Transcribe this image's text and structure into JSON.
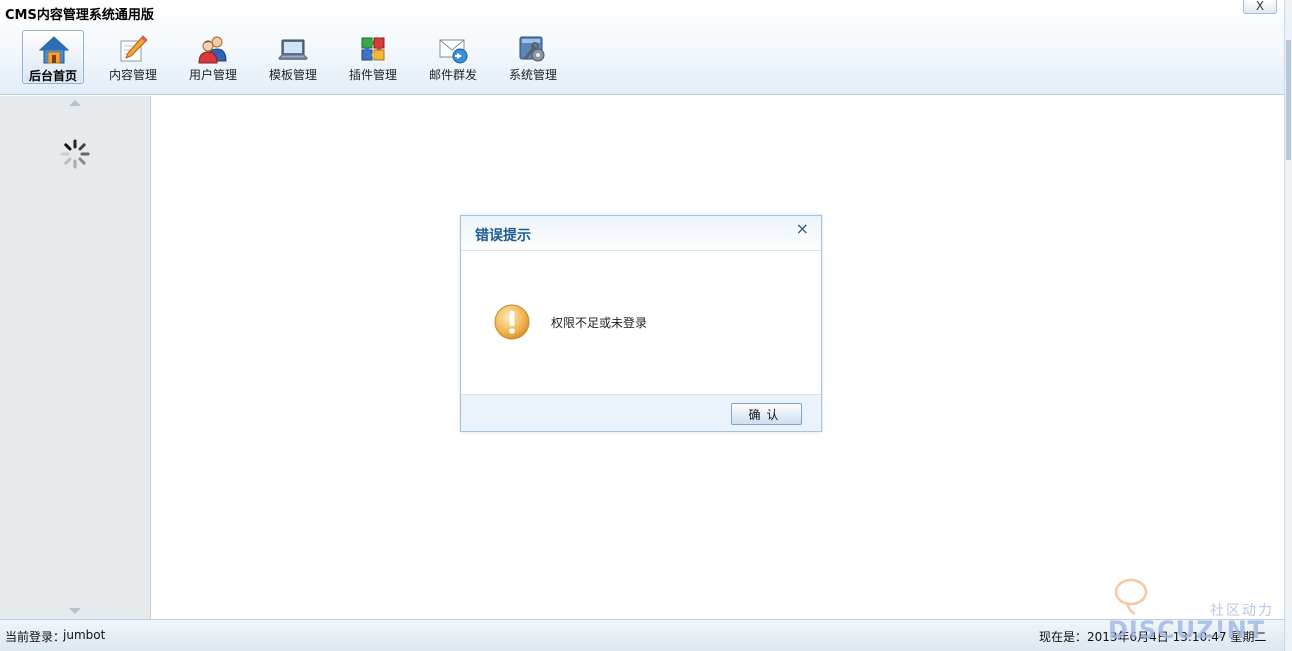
{
  "app": {
    "title": "CMS内容管理系统通用版",
    "close_glyph": "X"
  },
  "toolbar": {
    "items": [
      {
        "label": "后台首页",
        "icon": "home-icon",
        "active": true
      },
      {
        "label": "内容管理",
        "icon": "edit-pencil-icon",
        "active": false
      },
      {
        "label": "用户管理",
        "icon": "users-icon",
        "active": false
      },
      {
        "label": "模板管理",
        "icon": "laptop-icon",
        "active": false
      },
      {
        "label": "插件管理",
        "icon": "puzzle-icon",
        "active": false
      },
      {
        "label": "邮件群发",
        "icon": "mail-send-icon",
        "active": false
      },
      {
        "label": "系统管理",
        "icon": "settings-tools-icon",
        "active": false
      }
    ]
  },
  "sidebar": {
    "loading_icon": "spinner-icon"
  },
  "dialog": {
    "title": "错误提示",
    "close_glyph": "×",
    "icon": "warning-icon",
    "message": "权限不足或未登录",
    "ok_label": "确认"
  },
  "status": {
    "login_label": "当前登录：",
    "login_user": "jumbot",
    "clock": "现在是：2013年6月4日 13:10:47 星期二"
  },
  "watermark": {
    "cn": "社区动力",
    "en": "DISCUZ!NT"
  },
  "colors": {
    "accent": "#1f5a8c",
    "header_bg": "#e2eef8",
    "sidebar_bg": "#e6eaed",
    "dialog_footer": "#eaf3fb",
    "warning": "#f2b552"
  }
}
